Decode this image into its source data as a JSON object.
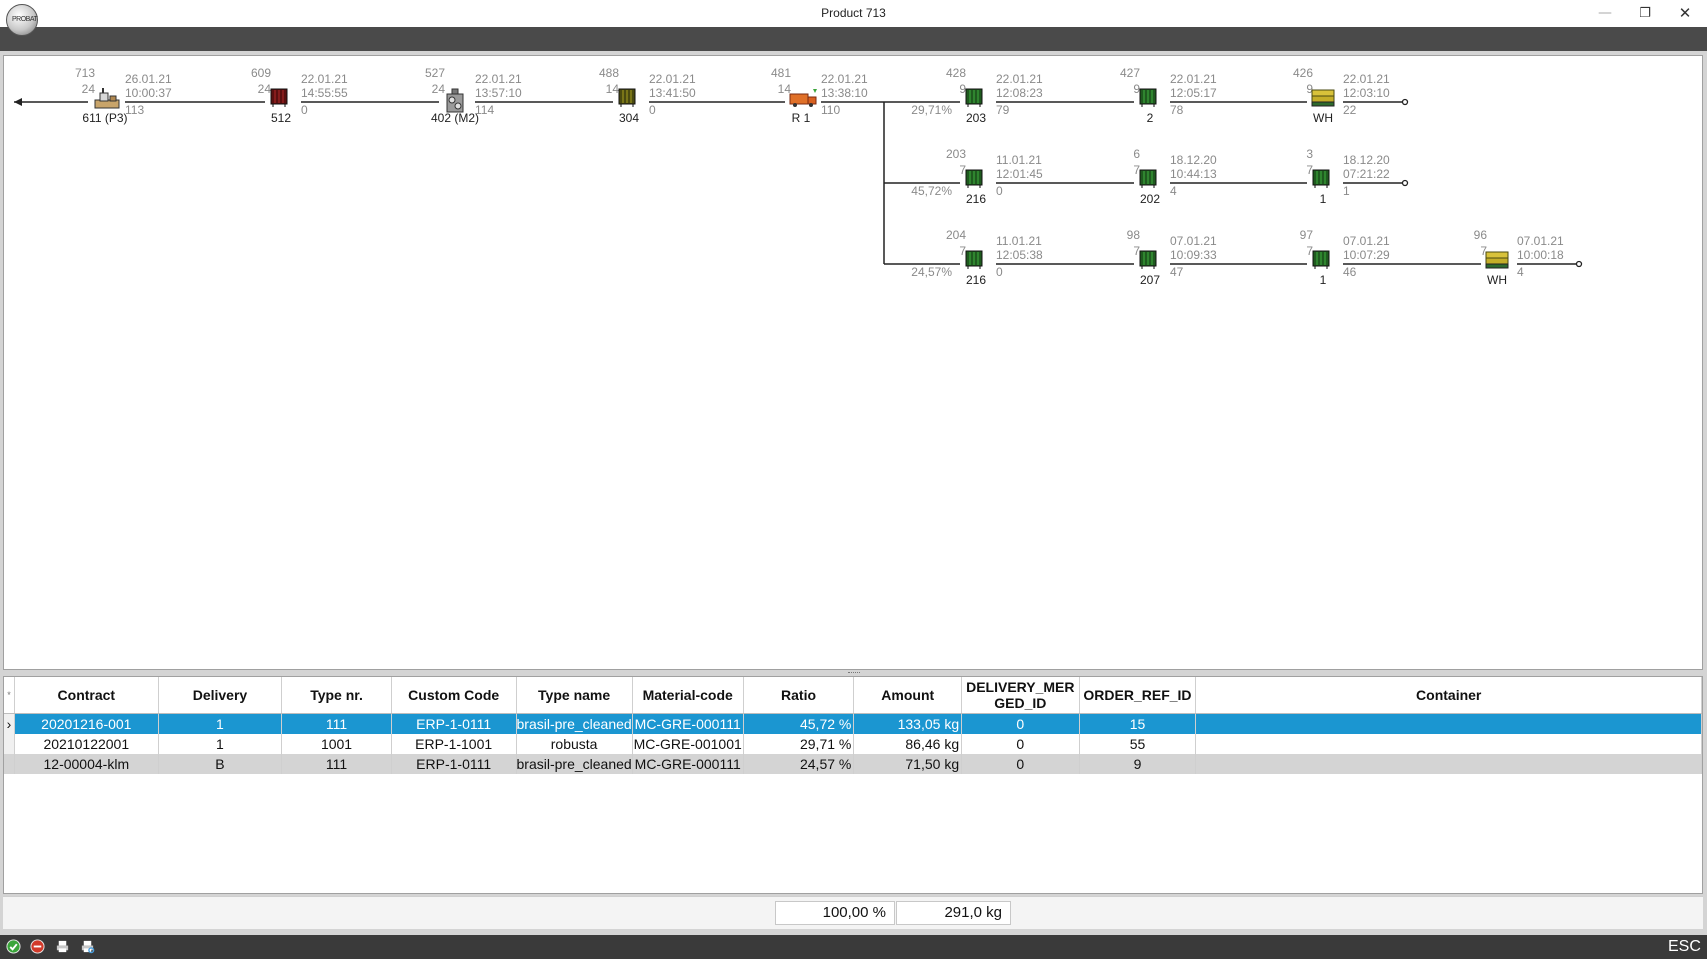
{
  "window": {
    "title": "Product 713",
    "min_symbol": "—",
    "max_symbol": "❐",
    "close_symbol": "✕",
    "logo_text": "PROBAT"
  },
  "graph": {
    "main": [
      {
        "count_top": "713",
        "count_bottom": "24",
        "date": "26.01.21",
        "time": "10:00:37",
        "value": "113",
        "label": "611 (P3)",
        "icon": "roaster-machine-icon"
      },
      {
        "count_top": "609",
        "count_bottom": "24",
        "date": "22.01.21",
        "time": "14:55:55",
        "value": "0",
        "label": "512",
        "icon": "silo-dark-red-icon"
      },
      {
        "count_top": "527",
        "count_bottom": "24",
        "date": "22.01.21",
        "time": "13:57:10",
        "value": "114",
        "label": "402 (M2)",
        "icon": "grinder-machine-icon"
      },
      {
        "count_top": "488",
        "count_bottom": "14",
        "date": "22.01.21",
        "time": "13:41:50",
        "value": "0",
        "label": "304",
        "icon": "silo-olive-icon"
      },
      {
        "count_top": "481",
        "count_bottom": "14",
        "date": "22.01.21",
        "time": "13:38:10",
        "value": "110",
        "label": "R 1",
        "icon": "receiving-truck-icon"
      }
    ],
    "branches": [
      {
        "ratio": "29,71%",
        "nodes": [
          {
            "count_top": "428",
            "count_bottom": "9",
            "date": "22.01.21",
            "time": "12:08:23",
            "value": "79",
            "label": "203",
            "icon": "silo-green-icon"
          },
          {
            "count_top": "427",
            "count_bottom": "9",
            "date": "22.01.21",
            "time": "12:05:17",
            "value": "78",
            "label": "2",
            "icon": "silo-green-icon"
          },
          {
            "count_top": "426",
            "count_bottom": "9",
            "date": "22.01.21",
            "time": "12:03:10",
            "value": "22",
            "label": "WH",
            "icon": "warehouse-pallet-icon"
          }
        ]
      },
      {
        "ratio": "45,72%",
        "nodes": [
          {
            "count_top": "203",
            "count_bottom": "7",
            "date": "11.01.21",
            "time": "12:01:45",
            "value": "0",
            "label": "216",
            "icon": "silo-green-icon"
          },
          {
            "count_top": "6",
            "count_bottom": "7",
            "date": "18.12.20",
            "time": "10:44:13",
            "value": "4",
            "label": "202",
            "icon": "silo-green-icon"
          },
          {
            "count_top": "3",
            "count_bottom": "7",
            "date": "18.12.20",
            "time": "07:21:22",
            "value": "1",
            "label": "1",
            "icon": "silo-green-icon"
          }
        ]
      },
      {
        "ratio": "24,57%",
        "nodes": [
          {
            "count_top": "204",
            "count_bottom": "7",
            "date": "11.01.21",
            "time": "12:05:38",
            "value": "0",
            "label": "216",
            "icon": "silo-green-icon"
          },
          {
            "count_top": "98",
            "count_bottom": "7",
            "date": "07.01.21",
            "time": "10:09:33",
            "value": "47",
            "label": "207",
            "icon": "silo-green-icon"
          },
          {
            "count_top": "97",
            "count_bottom": "7",
            "date": "07.01.21",
            "time": "10:07:29",
            "value": "46",
            "label": "1",
            "icon": "silo-green-icon"
          },
          {
            "count_top": "96",
            "count_bottom": "7",
            "date": "07.01.21",
            "time": "10:00:18",
            "value": "4",
            "label": "WH",
            "icon": "warehouse-pallet-icon"
          }
        ]
      }
    ]
  },
  "table": {
    "columns": [
      "Contract",
      "Delivery",
      "Type nr.",
      "Custom Code",
      "Type name",
      "Material-code",
      "Ratio",
      "Amount",
      "DELIVERY_MERGED_ID",
      "ORDER_REF_ID",
      "Container"
    ],
    "rows": [
      [
        "20201216-001",
        "1",
        "111",
        "ERP-1-0111",
        "brasil-pre_cleaned",
        "MC-GRE-000111",
        "45,72 %",
        "133,05 kg",
        "0",
        "15",
        ""
      ],
      [
        "20210122001",
        "1",
        "1001",
        "ERP-1-1001",
        "robusta",
        "MC-GRE-001001",
        "29,71 %",
        "86,46 kg",
        "0",
        "55",
        ""
      ],
      [
        "12-00004-klm",
        "B",
        "111",
        "ERP-1-0111",
        "brasil-pre_cleaned",
        "MC-GRE-000111",
        "24,57 %",
        "71,50 kg",
        "0",
        "9",
        ""
      ]
    ],
    "selected_row": 0,
    "row_indicator": "›",
    "header_indicator": "*"
  },
  "footer": {
    "ratio_total": "100,00 %",
    "amount_total": "291,0 kg"
  },
  "statusbar": {
    "esc_label": "ESC",
    "icons": [
      "ok-icon",
      "cancel-icon",
      "print-icon",
      "print-preview-icon"
    ]
  },
  "colors": {
    "selection": "#1b96d1",
    "silo_green": "#1f5a1f",
    "silo_red": "#5a0f0f",
    "silo_olive": "#4a4a10"
  }
}
